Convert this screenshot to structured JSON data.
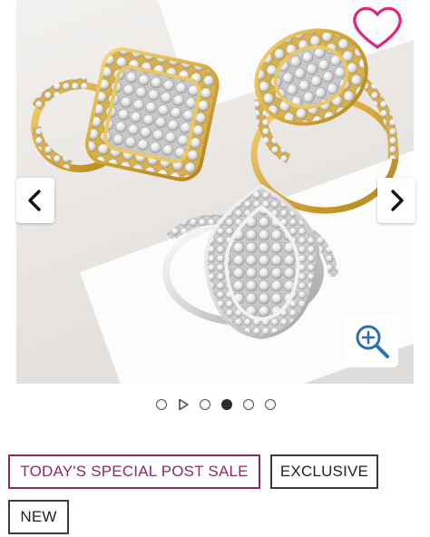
{
  "gallery": {
    "image_alt": "Three diamond cluster rings: two yellow gold and one white gold teardrop halo ring",
    "prev_icon": "chevron-left-icon",
    "next_icon": "chevron-right-icon",
    "favorite_icon": "heart-outline-icon",
    "favorite_color": "#e0267a",
    "zoom_icon": "zoom-in-icon",
    "zoom_color": "#2c6fb3"
  },
  "carousel": {
    "slide_count": 5,
    "play_slide_index": 1,
    "active_index": 3
  },
  "badges": {
    "special": "TODAY'S SPECIAL POST SALE",
    "exclusive": "EXCLUSIVE",
    "new": "NEW"
  },
  "colors": {
    "special_badge": "#8e2a5c",
    "badge_border": "#3c3c3c",
    "dot_active": "#2b2b2b"
  }
}
